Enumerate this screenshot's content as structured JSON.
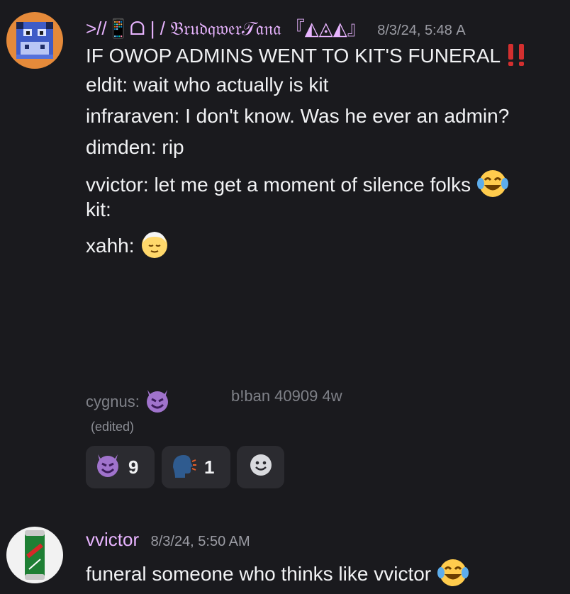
{
  "messages": [
    {
      "username": ">//📱ᗝ | / 𝔅𝔯𝔲𝔡𝔮𝔴𝔢𝔯𝒯𝔞𝔫𝔞 『◭◬◭』",
      "timestamp": "8/3/24, 5:48 A",
      "lines": [
        "IF OWOP ADMINS WENT TO KIT'S FUNERAL",
        "eldit: wait who actually is kit",
        "infraraven: I don't know. Was he ever an admin?",
        "dimden: rip",
        "vvictor: let me get a moment of silence folks",
        "kit:",
        "xahh:"
      ],
      "bottom_left": "cygnus:",
      "bottom_right": "b!ban 40909 4w",
      "edited": "(edited)",
      "reactions": [
        {
          "icon": "smiling-imp-icon",
          "count": "9"
        },
        {
          "icon": "speaking-head-icon",
          "count": "1"
        },
        {
          "icon": "add-reaction-icon",
          "count": ""
        }
      ]
    },
    {
      "username": "vvictor",
      "timestamp": "8/3/24, 5:50 AM",
      "lines": [
        "funeral someone who thinks like vvictor"
      ]
    }
  ],
  "colors": {
    "background": "#1a1a1e",
    "username": "#e8b4ff",
    "reaction_bg": "#2b2b30"
  }
}
